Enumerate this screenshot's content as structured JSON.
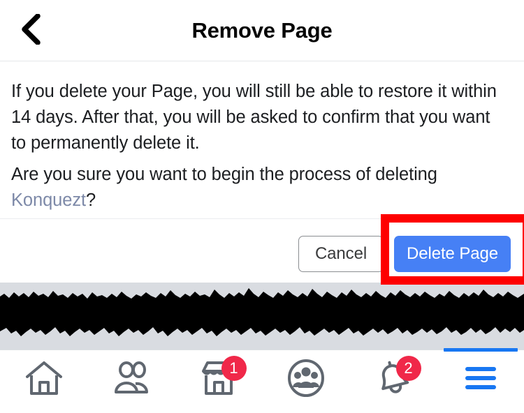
{
  "header": {
    "title": "Remove Page",
    "back_icon": "chevron-left-icon"
  },
  "body": {
    "paragraph_1": "If you delete your Page, you will still be able to restore it within 14 days. After that, you will be asked to confirm that you want to permanently delete it.",
    "paragraph_2_prefix": "Are you sure you want to begin the process of deleting ",
    "page_name": "Konquezt",
    "paragraph_2_suffix": "?"
  },
  "actions": {
    "cancel_label": "Cancel",
    "delete_label": "Delete Page"
  },
  "colors": {
    "primary_blue": "#4680f5",
    "link_blue_gray": "#7d89a8",
    "badge_red": "#f02849",
    "annotation_red": "#fe0000",
    "nav_active_blue": "#1877f2",
    "nav_icon_gray": "#606770",
    "redaction_gray": "#d9dce1"
  },
  "bottom_nav": {
    "items": [
      {
        "name": "home",
        "icon": "home-icon",
        "badge": null,
        "active": false
      },
      {
        "name": "friends",
        "icon": "friends-icon",
        "badge": null,
        "active": false
      },
      {
        "name": "marketplace",
        "icon": "marketplace-icon",
        "badge": "1",
        "active": false
      },
      {
        "name": "groups",
        "icon": "groups-icon",
        "badge": null,
        "active": false
      },
      {
        "name": "notifications",
        "icon": "bell-icon",
        "badge": "2",
        "active": false
      },
      {
        "name": "menu",
        "icon": "hamburger-menu-icon",
        "badge": null,
        "active": true
      }
    ]
  }
}
